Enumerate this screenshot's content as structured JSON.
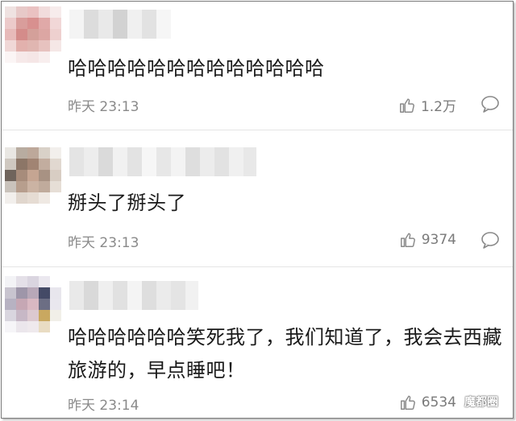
{
  "comments": [
    {
      "text": "哈哈哈哈哈哈哈哈哈哈哈哈哈",
      "time": "昨天 23:13",
      "likes": "1.2万"
    },
    {
      "text": "掰头了掰头了",
      "time": "昨天 23:13",
      "likes": "9374"
    },
    {
      "text": "哈哈哈哈哈哈笑死我了，我们知道了，我会去西藏旅游的，早点睡吧！",
      "time": "昨天 23:14",
      "likes": "6534"
    }
  ],
  "watermark": "魔都圈",
  "icons": {
    "like": "thumbs-up-icon",
    "reply": "speech-bubble-icon"
  },
  "colors": {
    "text": "#1a1a1a",
    "meta": "#8a8a8a",
    "divider": "#e5e5e5"
  }
}
